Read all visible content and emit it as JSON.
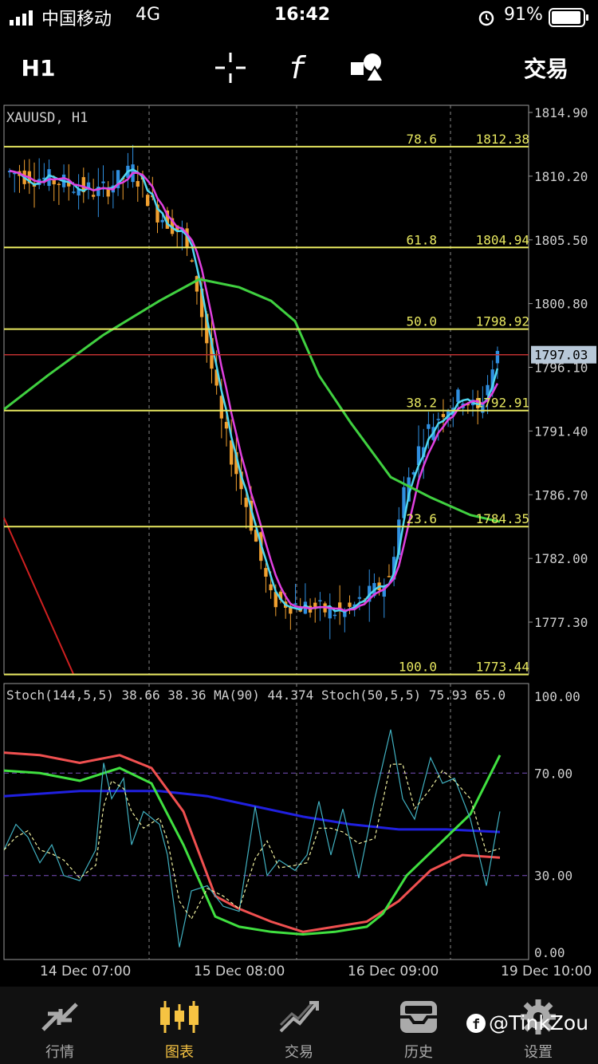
{
  "status": {
    "carrier": "中国移动",
    "network": "4G",
    "time": "16:42",
    "battery": "91%"
  },
  "toolbar": {
    "timeframe": "H1",
    "crosshair_icon": "crosshair-icon",
    "indicator_icon": "function-icon",
    "objects_icon": "shapes-icon",
    "trade": "交易"
  },
  "chart": {
    "symbol": "XAUUSD, H1",
    "price_labels": [
      "1814.90",
      "1810.20",
      "1805.50",
      "1800.80",
      "1796.10",
      "1791.40",
      "1786.70",
      "1782.00",
      "1777.30"
    ],
    "current_price": "1797.03",
    "fibonacci": [
      {
        "level": "78.6",
        "price": "1812.38"
      },
      {
        "level": "61.8",
        "price": "1804.94"
      },
      {
        "level": "50.0",
        "price": "1798.92"
      },
      {
        "level": "38.2",
        "price": "1792.91"
      },
      {
        "level": "23.6",
        "price": "1784.35"
      },
      {
        "level": "100.0",
        "price": "1773.44"
      }
    ],
    "colors": {
      "bull": "#2f8fe0",
      "bear": "#f0a030",
      "ma_fast": "#4fd6f0",
      "ma_slow": "#e040e0",
      "ma_long": "#40d040",
      "fib": "#e8e860",
      "price_line": "#c03030"
    }
  },
  "stoch": {
    "header": "Stoch(144,5,5) 38.66 38.36 MA(90) 44.374 Stoch(50,5,5) 75.93 65.0",
    "levels": [
      "100.00",
      "70.00",
      "30.00",
      "0.00"
    ]
  },
  "xaxis": {
    "labels": [
      "14 Dec 07:00",
      "15 Dec 08:00",
      "16 Dec 09:00",
      "19 Dec 10:00"
    ]
  },
  "tabs": [
    {
      "label": "行情",
      "icon": "quotes-icon"
    },
    {
      "label": "图表",
      "icon": "candlestick-icon"
    },
    {
      "label": "交易",
      "icon": "trade-icon"
    },
    {
      "label": "历史",
      "icon": "history-icon"
    },
    {
      "label": "设置",
      "icon": "gear-icon"
    }
  ],
  "watermark": "@TinkZou"
}
